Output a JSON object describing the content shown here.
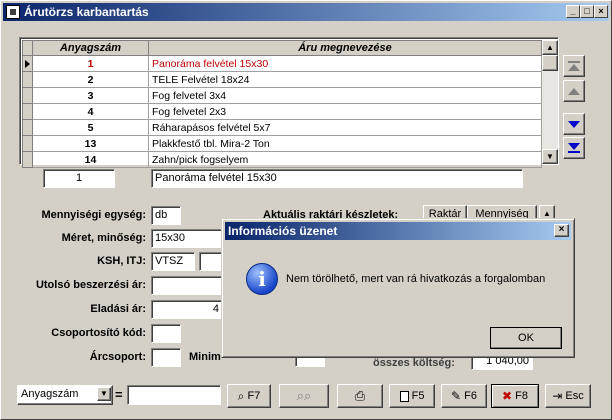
{
  "window": {
    "title": "Árutörzs karbantartás",
    "min": "_",
    "max": "□",
    "close": "×"
  },
  "grid": {
    "col_code": "Anyagszám",
    "col_name": "Áru megnevezése",
    "rows": [
      {
        "code": "1",
        "name": "Panoráma felvétel 15x30"
      },
      {
        "code": "2",
        "name": "TELE Felvétel 18x24"
      },
      {
        "code": "3",
        "name": "Fog felvetel 3x4"
      },
      {
        "code": "4",
        "name": "Fog felvetel 2x3"
      },
      {
        "code": "5",
        "name": "Ráharapásos felvétel 5x7"
      },
      {
        "code": "13",
        "name": "Plakkfestő tbl. Mira-2 Ton"
      },
      {
        "code": "14",
        "name": "Zahn/pick fogselyem"
      }
    ],
    "selected_row": 0
  },
  "current": {
    "code": "1",
    "name": "Panoráma felvétel 15x30"
  },
  "form": {
    "unit_label": "Mennyiségi egység:",
    "unit_value": "db",
    "size_label": "Méret, minőség:",
    "size_value": "15x30",
    "ksh_label": "KSH, ITJ:",
    "ksh_value": "VTSZ",
    "last_price_label": "Utolsó beszerzési ár:",
    "last_price_value": "",
    "sale_price_label": "Eladási ár:",
    "sale_price_value": "4",
    "group_label": "Csoportosító kód:",
    "group_value": "",
    "price_group_label": "Árcsoport:",
    "price_group_value": "",
    "minimum_label": "Minim",
    "stock_label": "Aktuális raktári készletek:",
    "stock_btn_raktar": "Raktár",
    "stock_btn_mennyiseg": "Mennyiség",
    "cost_label": "összes költség:",
    "cost_value": "1 040,00"
  },
  "dialog": {
    "title": "Információs üzenet",
    "message": "Nem törölhető, mert van rá hivatkozás a forgalomban",
    "ok": "OK",
    "close": "×",
    "info_glyph": "i"
  },
  "toolbar": {
    "search_field_value": "Anyagszám",
    "equals": "=",
    "search_value": "",
    "f7": "F7",
    "f5": "F5",
    "f6": "F6",
    "f8": "F8",
    "esc": "Esc"
  }
}
